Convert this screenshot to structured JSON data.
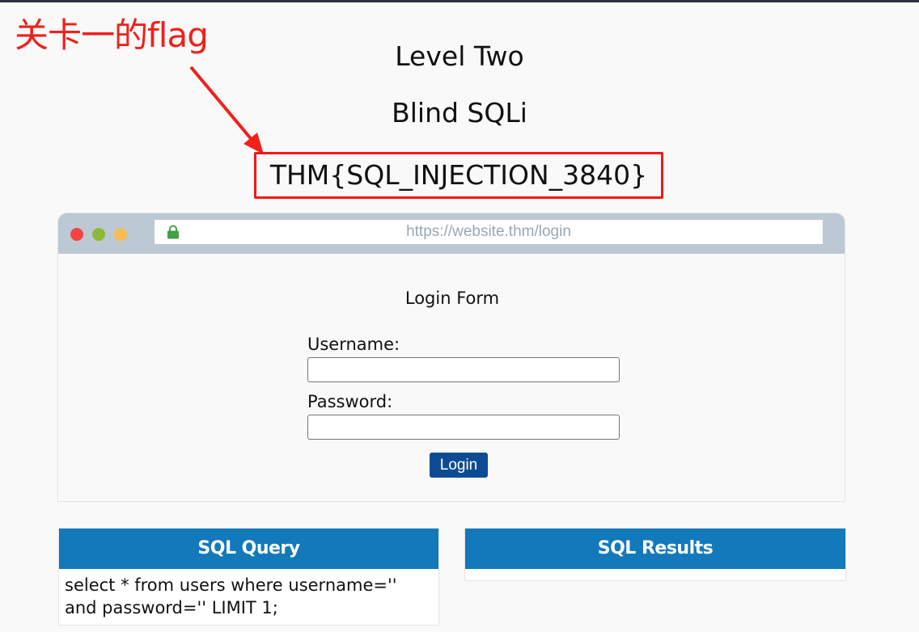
{
  "annotation": {
    "text": "关卡一的flag",
    "color": "#f0201a"
  },
  "level": {
    "title": "Level Two",
    "subtitle": "Blind SQLi",
    "flag": "THM{SQL_INJECTION_3840}"
  },
  "browser": {
    "url": "https://website.thm/login",
    "lock_icon": "lock-icon"
  },
  "login_form": {
    "title": "Login Form",
    "username_label": "Username:",
    "username_value": "",
    "password_label": "Password:",
    "password_value": "",
    "submit_label": "Login"
  },
  "sql_query": {
    "heading": "SQL Query",
    "text": "select * from users where username='' and password='' LIMIT 1;"
  },
  "sql_results": {
    "heading": "SQL Results",
    "text": ""
  },
  "colors": {
    "accent_red": "#ee1a1a",
    "panel_header": "#1279ba",
    "login_button": "#0d4c93",
    "browser_bar": "#bcc8d3"
  }
}
